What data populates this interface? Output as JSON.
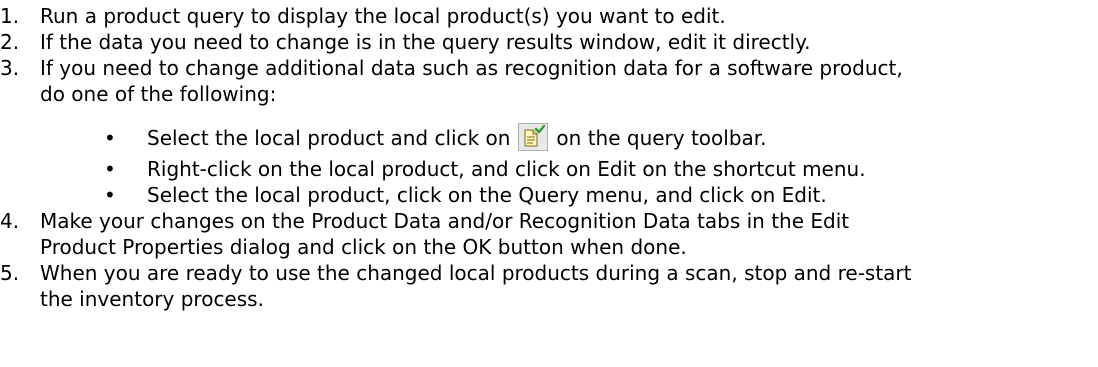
{
  "steps": [
    {
      "number": "1.",
      "text": "Run a product query to display the local product(s) you want to edit."
    },
    {
      "number": "2.",
      "text": "If the data you need to change is in the query results window, edit it directly."
    },
    {
      "number": "3.",
      "line1": "If you need to change additional data such as recognition data for a software product,",
      "line2": "do one of the following:"
    },
    {
      "number": "4.",
      "line1": "Make your changes on the Product Data and/or Recognition Data tabs in the Edit",
      "line2": "Product Properties dialog and click on the OK button when done."
    },
    {
      "number": "5.",
      "line1": "When you are ready to use the changed local products during a scan, stop and re-start",
      "line2": "the inventory process."
    }
  ],
  "bullets": {
    "marker": "•",
    "b1_before": "Select the local product and click on",
    "b1_after": "on the query toolbar.",
    "b1_icon": "edit-product-icon",
    "b2": "Right-click on the local product, and click on Edit on the shortcut menu.",
    "b3": "Select the local product, click on the Query menu, and click on Edit."
  }
}
